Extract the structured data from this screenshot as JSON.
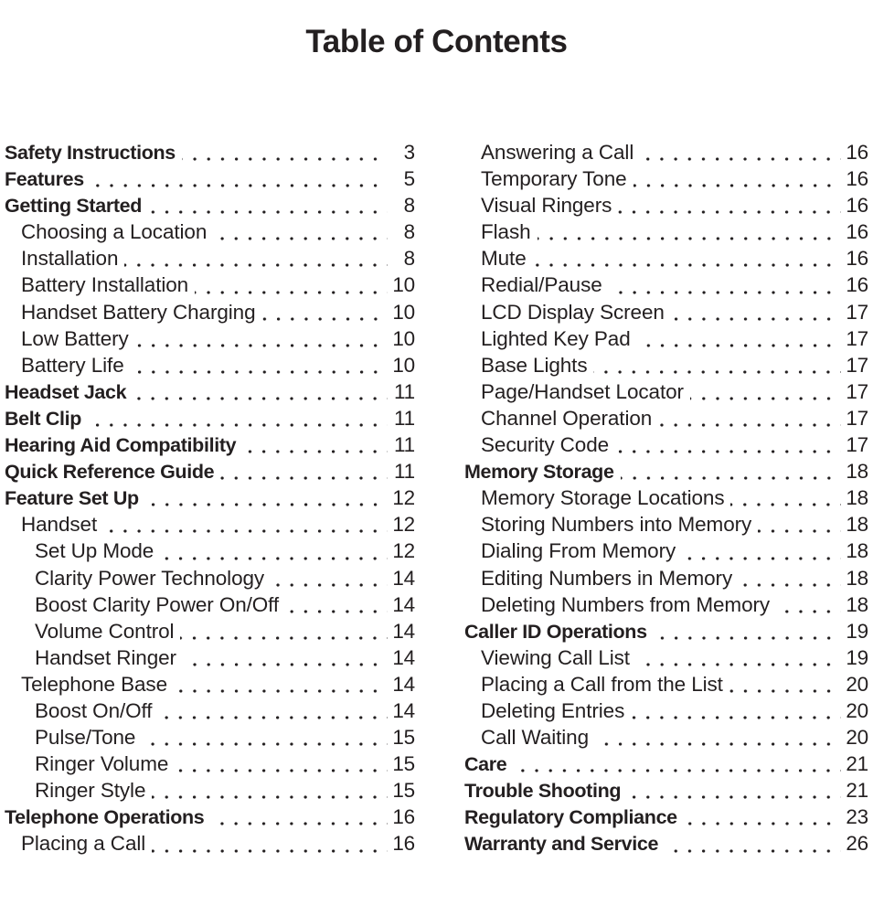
{
  "document": {
    "title": "Table of Contents",
    "text_color": "#231f20",
    "background_color": "#ffffff",
    "leader_style": "dotted"
  },
  "toc": {
    "left_column": [
      {
        "label": "Safety Instructions",
        "page": "3",
        "level": 0
      },
      {
        "label": "Features",
        "page": "5",
        "level": 0
      },
      {
        "label": "Getting Started",
        "page": "8",
        "level": 0
      },
      {
        "label": "Choosing a Location",
        "page": "8",
        "level": 1
      },
      {
        "label": "Installation",
        "page": "8",
        "level": 1
      },
      {
        "label": "Battery Installation",
        "page": "10",
        "level": 1
      },
      {
        "label": "Handset Battery Charging",
        "page": "10",
        "level": 1
      },
      {
        "label": "Low Battery",
        "page": "10",
        "level": 1
      },
      {
        "label": "Battery Life",
        "page": "10",
        "level": 1
      },
      {
        "label": "Headset Jack",
        "page": "11",
        "level": 0
      },
      {
        "label": "Belt Clip",
        "page": "11",
        "level": 0
      },
      {
        "label": "Hearing Aid Compatibility",
        "page": "11",
        "level": 0
      },
      {
        "label": "Quick Reference Guide",
        "page": "11",
        "level": 0
      },
      {
        "label": "Feature Set Up",
        "page": "12",
        "level": 0
      },
      {
        "label": "Handset",
        "page": "12",
        "level": 1
      },
      {
        "label": "Set Up Mode",
        "page": "12",
        "level": 2
      },
      {
        "label": "Clarity Power Technology",
        "page": "14",
        "level": 2
      },
      {
        "label": "Boost Clarity Power On/Off",
        "page": "14",
        "level": 2
      },
      {
        "label": "Volume Control",
        "page": "14",
        "level": 2
      },
      {
        "label": "Handset Ringer",
        "page": "14",
        "level": 2
      },
      {
        "label": "Telephone Base",
        "page": "14",
        "level": 1
      },
      {
        "label": "Boost On/Off",
        "page": "14",
        "level": 2
      },
      {
        "label": "Pulse/Tone",
        "page": "15",
        "level": 2
      },
      {
        "label": "Ringer Volume",
        "page": "15",
        "level": 2
      },
      {
        "label": "Ringer Style",
        "page": "15",
        "level": 2
      },
      {
        "label": "Telephone Operations",
        "page": "16",
        "level": 0
      },
      {
        "label": "Placing a Call",
        "page": "16",
        "level": 1
      }
    ],
    "right_column": [
      {
        "label": "Answering a Call",
        "page": "16",
        "level": 1
      },
      {
        "label": "Temporary Tone",
        "page": "16",
        "level": 1
      },
      {
        "label": "Visual Ringers",
        "page": "16",
        "level": 1
      },
      {
        "label": "Flash",
        "page": "16",
        "level": 1
      },
      {
        "label": "Mute",
        "page": "16",
        "level": 1
      },
      {
        "label": "Redial/Pause",
        "page": "16",
        "level": 1
      },
      {
        "label": "LCD Display Screen",
        "page": "17",
        "level": 1
      },
      {
        "label": "Lighted Key Pad",
        "page": "17",
        "level": 1
      },
      {
        "label": "Base Lights",
        "page": "17",
        "level": 1
      },
      {
        "label": "Page/Handset Locator",
        "page": "17",
        "level": 1
      },
      {
        "label": "Channel Operation",
        "page": "17",
        "level": 1
      },
      {
        "label": "Security Code",
        "page": "17",
        "level": 1
      },
      {
        "label": "Memory Storage",
        "page": "18",
        "level": 0
      },
      {
        "label": "Memory Storage Locations",
        "page": "18",
        "level": 1
      },
      {
        "label": "Storing Numbers into Memory",
        "page": "18",
        "level": 1
      },
      {
        "label": "Dialing From Memory",
        "page": "18",
        "level": 1
      },
      {
        "label": "Editing Numbers in Memory",
        "page": "18",
        "level": 1
      },
      {
        "label": "Deleting Numbers from Memory",
        "page": "18",
        "level": 1
      },
      {
        "label": "Caller ID Operations",
        "page": "19",
        "level": 0
      },
      {
        "label": "Viewing Call List",
        "page": "19",
        "level": 1
      },
      {
        "label": "Placing a Call from the List",
        "page": "20",
        "level": 1
      },
      {
        "label": "Deleting Entries",
        "page": "20",
        "level": 1
      },
      {
        "label": "Call Waiting",
        "page": "20",
        "level": 1
      },
      {
        "label": "Care",
        "page": "21",
        "level": 0
      },
      {
        "label": "Trouble Shooting",
        "page": "21",
        "level": 0
      },
      {
        "label": "Regulatory Compliance",
        "page": "23",
        "level": 0
      },
      {
        "label": "Warranty and Service",
        "page": "26",
        "level": 0
      }
    ]
  }
}
